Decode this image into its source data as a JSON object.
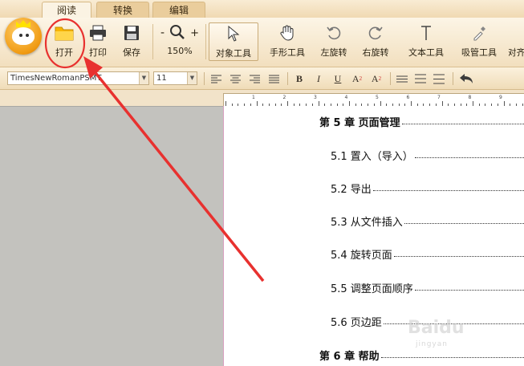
{
  "tabs": [
    {
      "label": "阅读",
      "active": true
    },
    {
      "label": "转换",
      "active": false
    },
    {
      "label": "编辑",
      "active": false
    }
  ],
  "ribbon": {
    "open_label": "打开",
    "print_label": "打印",
    "save_label": "保存",
    "zoom_out": "-",
    "zoom_in": "+",
    "zoom_value": "150%",
    "object_tool_label": "对象工具",
    "hand_tool_label": "手形工具",
    "rotate_left_label": "左旋转",
    "rotate_right_label": "右旋转",
    "text_tool_label": "文本工具",
    "eyedropper_label": "吸管工具",
    "more_label": "对齐"
  },
  "format": {
    "font_name": "TimesNewRomanPSMT",
    "font_size": "11",
    "bold": "B",
    "italic": "I",
    "underline": "U",
    "superscript": "A",
    "superscript_mark": "2",
    "subscript": "A",
    "subscript_mark": "2"
  },
  "ruler": {
    "labels": [
      "1",
      "2",
      "3",
      "4",
      "5",
      "6",
      "7",
      "8",
      "9"
    ]
  },
  "document": {
    "toc": [
      {
        "text": "第 5 章  页面管理",
        "level": 1
      },
      {
        "text": "5.1 置入（导入）",
        "level": 2
      },
      {
        "text": "5.2 导出",
        "level": 2
      },
      {
        "text": "5.3 从文件插入",
        "level": 2
      },
      {
        "text": "5.4 旋转页面",
        "level": 2
      },
      {
        "text": "5.5 调整页面顺序",
        "level": 2
      },
      {
        "text": "5.6 页边距",
        "level": 2
      },
      {
        "text": "第 6 章  帮助",
        "level": 1
      }
    ]
  },
  "watermark": {
    "text": "Baidu",
    "sub": "jingyan"
  },
  "colors": {
    "annotation": "#e8312f",
    "accent": "#f09a12"
  }
}
